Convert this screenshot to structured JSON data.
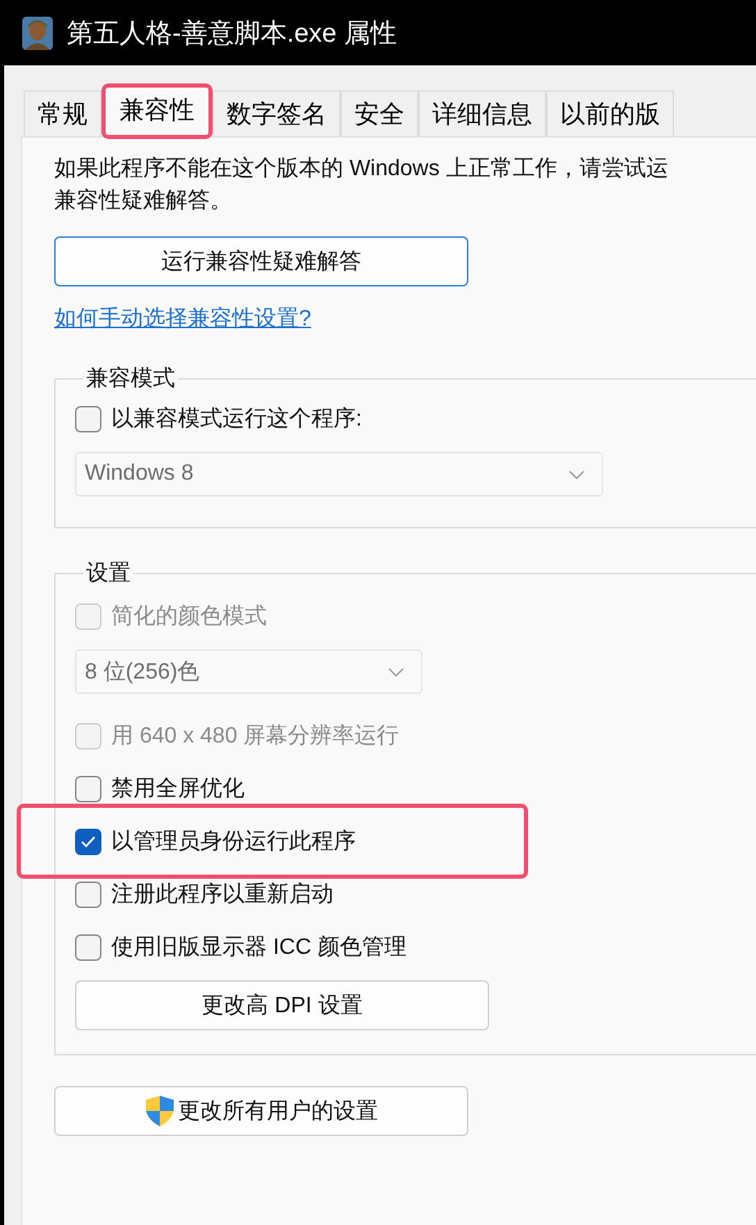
{
  "window": {
    "title": "第五人格-善意脚本.exe 属性"
  },
  "tabs": [
    {
      "label": "常规",
      "selected": false,
      "highlighted": false
    },
    {
      "label": "兼容性",
      "selected": true,
      "highlighted": true
    },
    {
      "label": "数字签名",
      "selected": false,
      "highlighted": false
    },
    {
      "label": "安全",
      "selected": false,
      "highlighted": false
    },
    {
      "label": "详细信息",
      "selected": false,
      "highlighted": false
    },
    {
      "label": "以前的版",
      "selected": false,
      "highlighted": false
    }
  ],
  "description": [
    "如果此程序不能在这个版本的 Windows 上正常工作，请尝试运",
    "兼容性疑难解答。"
  ],
  "troubleshoot_button": "运行兼容性疑难解答",
  "help_link": "如何手动选择兼容性设置?",
  "compat_mode": {
    "title": "兼容模式",
    "items": [
      {
        "kind": "checkbox",
        "label": "以兼容模式运行这个程序:",
        "checked": false,
        "disabled": false,
        "highlighted": false
      },
      {
        "kind": "dropdown",
        "value": "Windows 8",
        "disabled": true
      }
    ]
  },
  "settings": {
    "title": "设置",
    "items": [
      {
        "kind": "checkbox",
        "label": "简化的颜色模式",
        "checked": false,
        "disabled": true,
        "highlighted": false
      },
      {
        "kind": "dropdown",
        "value": "8 位(256)色",
        "disabled": true
      },
      {
        "kind": "checkbox",
        "label": "用 640 x 480 屏幕分辨率运行",
        "checked": false,
        "disabled": true,
        "highlighted": false
      },
      {
        "kind": "checkbox",
        "label": "禁用全屏优化",
        "checked": false,
        "disabled": false,
        "highlighted": false
      },
      {
        "kind": "checkbox",
        "label": "以管理员身份运行此程序",
        "checked": true,
        "disabled": false,
        "highlighted": true
      },
      {
        "kind": "checkbox",
        "label": "注册此程序以重新启动",
        "checked": false,
        "disabled": false,
        "highlighted": false
      },
      {
        "kind": "checkbox",
        "label": "使用旧版显示器 ICC 颜色管理",
        "checked": false,
        "disabled": false,
        "highlighted": false
      },
      {
        "kind": "button",
        "label": "更改高 DPI 设置"
      }
    ]
  },
  "all_users_button": "更改所有用户的设置"
}
